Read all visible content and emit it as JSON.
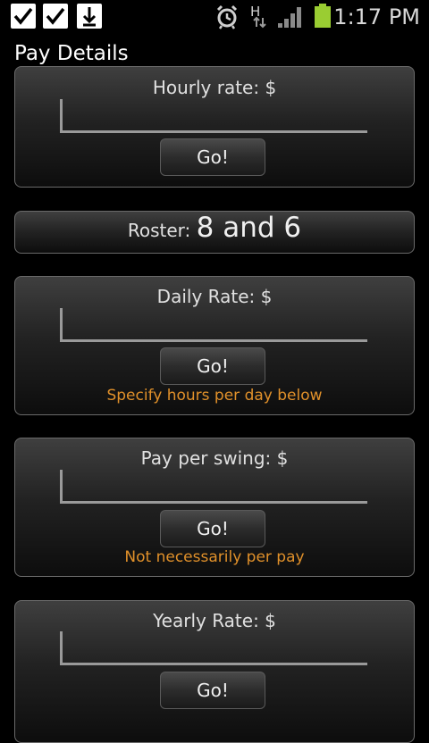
{
  "status_bar": {
    "notification_icons": [
      "checkbox-icon",
      "checkbox-icon",
      "download-icon"
    ],
    "right_icons": [
      "alarm-icon",
      "hspa-data-icon",
      "signal-icon",
      "battery-icon"
    ],
    "network_label": "H",
    "time": "1:17 PM"
  },
  "page": {
    "title": "Pay Details"
  },
  "cards": {
    "hourly": {
      "label": "Hourly rate: $",
      "input_value": "",
      "button": "Go!"
    },
    "daily": {
      "label": "Daily Rate: $",
      "input_value": "",
      "button": "Go!",
      "hint": "Specify hours per day below"
    },
    "swing": {
      "label": "Pay per swing: $",
      "input_value": "",
      "button": "Go!",
      "hint": "Not necessarily per pay"
    },
    "yearly": {
      "label": "Yearly Rate: $",
      "input_value": "",
      "button": "Go!"
    }
  },
  "roster": {
    "label": "Roster: ",
    "value": "8 and 6"
  },
  "colors": {
    "background": "#000000",
    "hint_text": "#e0902a",
    "battery": "#9acd32"
  }
}
